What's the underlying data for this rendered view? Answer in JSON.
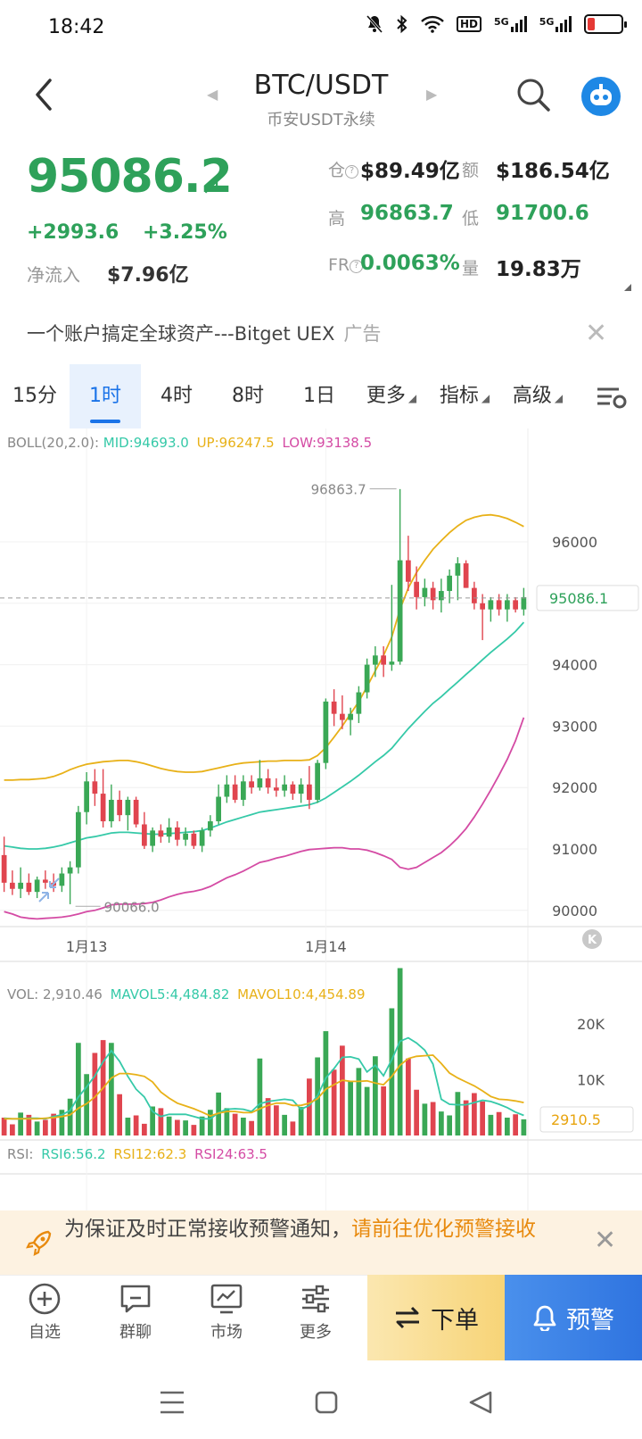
{
  "status_bar": {
    "time": "18:42",
    "battery_level": 0.2,
    "network_1": "5G",
    "network_2": "5G",
    "hd_badge": "HD"
  },
  "header": {
    "title": "BTC/USDT",
    "subtitle": "币安USDT永续"
  },
  "price": {
    "last": "95086.2",
    "change": "+2993.6",
    "change_pct": "+3.25%",
    "netflow_label": "净流入",
    "netflow_value": "$7.96亿"
  },
  "stats": {
    "oi_label": "仓",
    "oi_value": "$89.49亿",
    "amount_label": "额",
    "amount_value": "$186.54亿",
    "high_label": "高",
    "high_value": "96863.7",
    "low_label": "低",
    "low_value": "91700.6",
    "fr_label": "FR",
    "fr_value": "0.0063%",
    "vol_label": "量",
    "vol_value": "19.83万"
  },
  "ad": {
    "text": "一个账户搞定全球资产---Bitget UEX",
    "tag": "广告"
  },
  "tabs": [
    {
      "label": "15分"
    },
    {
      "label": "1时"
    },
    {
      "label": "4时"
    },
    {
      "label": "8时"
    },
    {
      "label": "1日"
    },
    {
      "label": "更多"
    },
    {
      "label": "指标"
    },
    {
      "label": "高级"
    }
  ],
  "chart_data": {
    "type": "candlestick",
    "boll": {
      "label": "BOLL(20,2.0):",
      "mid": "MID:94693.0",
      "up": "UP:96247.5",
      "low": "LOW:93138.5"
    },
    "price_axis": [
      "96000",
      "95000",
      "94000",
      "93000",
      "92000",
      "91000",
      "90000"
    ],
    "current_price_tag": "95086.1",
    "high_marker": "96863.7",
    "low_marker": "90066.0",
    "x_labels": [
      "1月13",
      "1月14"
    ],
    "vol": {
      "label": "VOL: 2,910.46",
      "mavol5": "MAVOL5:4,484.82",
      "mavol10": "MAVOL10:4,454.89"
    },
    "vol_axis": [
      "20K",
      "10K"
    ],
    "vol_tag": "2910.5",
    "rsi": {
      "label": "RSI:",
      "rsi6": "RSI6:56.2",
      "rsi12": "RSI12:62.3",
      "rsi24": "RSI24:63.5"
    },
    "colors": {
      "up": "#3aa856",
      "down": "#e0454f",
      "mid": "#35c9a8",
      "upper": "#e8b118",
      "lower": "#d44ba4"
    },
    "candles": [
      [
        90900,
        91200,
        90300,
        90450
      ],
      [
        90450,
        90650,
        90250,
        90350
      ],
      [
        90350,
        90700,
        90200,
        90450
      ],
      [
        90450,
        90600,
        90250,
        90300
      ],
      [
        90300,
        90550,
        90200,
        90500
      ],
      [
        90500,
        90650,
        90350,
        90450
      ],
      [
        90450,
        90600,
        90300,
        90400
      ],
      [
        90400,
        90700,
        90300,
        90600
      ],
      [
        90600,
        90800,
        90100,
        90700
      ],
      [
        90700,
        91700,
        90600,
        91600
      ],
      [
        91600,
        92250,
        91400,
        92100
      ],
      [
        92100,
        92300,
        91700,
        91900
      ],
      [
        91900,
        92300,
        91350,
        91450
      ],
      [
        91450,
        92050,
        91350,
        91800
      ],
      [
        91800,
        91950,
        91450,
        91550
      ],
      [
        91550,
        91850,
        91300,
        91800
      ],
      [
        91800,
        91850,
        91350,
        91400
      ],
      [
        91400,
        91600,
        91000,
        91050
      ],
      [
        91050,
        91350,
        90950,
        91300
      ],
      [
        91300,
        91400,
        91100,
        91200
      ],
      [
        91200,
        91500,
        91100,
        91350
      ],
      [
        91350,
        91450,
        91050,
        91150
      ],
      [
        91150,
        91350,
        91050,
        91250
      ],
      [
        91250,
        91300,
        91000,
        91050
      ],
      [
        91050,
        91350,
        90950,
        91300
      ],
      [
        91300,
        91550,
        91200,
        91450
      ],
      [
        91450,
        92050,
        91400,
        91850
      ],
      [
        91850,
        92200,
        91750,
        92050
      ],
      [
        92050,
        92200,
        91750,
        91800
      ],
      [
        91800,
        92200,
        91700,
        92100
      ],
      [
        92100,
        92200,
        91900,
        92000
      ],
      [
        92000,
        92450,
        91950,
        92150
      ],
      [
        92150,
        92300,
        91900,
        92000
      ],
      [
        92000,
        92150,
        91850,
        91950
      ],
      [
        91950,
        92200,
        91850,
        92050
      ],
      [
        92050,
        92100,
        91800,
        91900
      ],
      [
        91900,
        92150,
        91750,
        92050
      ],
      [
        92050,
        92350,
        91650,
        91800
      ],
      [
        91800,
        92450,
        91750,
        92400
      ],
      [
        92400,
        93450,
        92300,
        93400
      ],
      [
        93400,
        93600,
        93000,
        93200
      ],
      [
        93200,
        93500,
        92950,
        93100
      ],
      [
        93100,
        93300,
        92850,
        93200
      ],
      [
        93200,
        93650,
        93050,
        93550
      ],
      [
        93550,
        94100,
        93450,
        94000
      ],
      [
        94000,
        94300,
        93800,
        94150
      ],
      [
        94150,
        94300,
        93800,
        94000
      ],
      [
        94000,
        95300,
        93900,
        94050
      ],
      [
        94050,
        96860,
        94000,
        95700
      ],
      [
        95700,
        96100,
        95200,
        95350
      ],
      [
        95350,
        95600,
        94900,
        95100
      ],
      [
        95100,
        95400,
        94950,
        95250
      ],
      [
        95250,
        95350,
        94900,
        95050
      ],
      [
        95050,
        95400,
        94850,
        95200
      ],
      [
        95200,
        95550,
        95000,
        95450
      ],
      [
        95450,
        95750,
        95050,
        95650
      ],
      [
        95650,
        95700,
        95250,
        95250
      ],
      [
        95250,
        95350,
        94900,
        95000
      ],
      [
        95000,
        95150,
        94400,
        94900
      ],
      [
        94900,
        95100,
        94700,
        95050
      ],
      [
        95050,
        95150,
        94800,
        94900
      ],
      [
        94900,
        95150,
        94700,
        95050
      ],
      [
        95050,
        95100,
        94850,
        94900
      ],
      [
        94900,
        95250,
        94800,
        95100
      ]
    ],
    "volumes": [
      3200,
      2000,
      4100,
      3700,
      2500,
      2800,
      3900,
      4600,
      6600,
      16600,
      11000,
      14800,
      17100,
      16600,
      7400,
      3200,
      3600,
      2100,
      5200,
      4900,
      3400,
      2800,
      2700,
      1900,
      3400,
      4600,
      7700,
      4900,
      3900,
      3200,
      2600,
      13800,
      6700,
      5400,
      3700,
      2500,
      5100,
      10200,
      14000,
      18700,
      11800,
      16100,
      9800,
      12100,
      8700,
      14200,
      8800,
      22800,
      30000,
      13800,
      8200,
      5700,
      6000,
      4300,
      3600,
      7800,
      6300,
      7600,
      6100,
      3700,
      4200,
      3200,
      3800,
      2900
    ],
    "boll_mid": [
      91050,
      91030,
      91010,
      91000,
      91000,
      91010,
      91030,
      91060,
      91100,
      91140,
      91180,
      91200,
      91230,
      91260,
      91270,
      91270,
      91260,
      91250,
      91240,
      91240,
      91250,
      91260,
      91270,
      91280,
      91300,
      91340,
      91390,
      91440,
      91480,
      91520,
      91560,
      91600,
      91620,
      91640,
      91660,
      91680,
      91700,
      91720,
      91760,
      91830,
      91920,
      92010,
      92100,
      92200,
      92310,
      92420,
      92520,
      92640,
      92800,
      92960,
      93100,
      93240,
      93370,
      93480,
      93600,
      93720,
      93840,
      93960,
      94080,
      94200,
      94310,
      94420,
      94540,
      94690
    ],
    "boll_up": [
      92120,
      92120,
      92130,
      92130,
      92140,
      92150,
      92180,
      92230,
      92290,
      92340,
      92380,
      92400,
      92420,
      92430,
      92440,
      92440,
      92420,
      92390,
      92350,
      92310,
      92280,
      92260,
      92250,
      92250,
      92260,
      92290,
      92320,
      92350,
      92380,
      92400,
      92410,
      92420,
      92430,
      92430,
      92440,
      92440,
      92440,
      92450,
      92520,
      92650,
      92820,
      93000,
      93200,
      93400,
      93640,
      93900,
      94150,
      94450,
      94900,
      95250,
      95500,
      95700,
      95880,
      96020,
      96150,
      96260,
      96350,
      96400,
      96430,
      96440,
      96420,
      96380,
      96320,
      96250
    ],
    "boll_low": [
      89980,
      89940,
      89890,
      89870,
      89860,
      89870,
      89880,
      89890,
      89910,
      89940,
      89980,
      90000,
      90040,
      90090,
      90100,
      90100,
      90100,
      90110,
      90130,
      90170,
      90220,
      90260,
      90290,
      90310,
      90340,
      90390,
      90460,
      90530,
      90580,
      90640,
      90710,
      90780,
      90810,
      90850,
      90880,
      90920,
      90960,
      90990,
      91000,
      91010,
      91020,
      91020,
      91000,
      91000,
      90980,
      90940,
      90890,
      90830,
      90700,
      90670,
      90700,
      90780,
      90860,
      90940,
      91050,
      91180,
      91330,
      91520,
      91730,
      91960,
      92200,
      92460,
      92760,
      93140
    ],
    "mavol5": [
      3100,
      3000,
      3000,
      3100,
      3100,
      3000,
      3400,
      3700,
      4500,
      6900,
      8700,
      10700,
      13200,
      15200,
      13300,
      10600,
      8300,
      6900,
      4300,
      3400,
      3800,
      3800,
      3800,
      3400,
      3000,
      3000,
      4100,
      4700,
      4800,
      4700,
      4300,
      5700,
      6100,
      6300,
      6500,
      6300,
      4700,
      5400,
      7100,
      10300,
      12000,
      14000,
      14100,
      13700,
      11400,
      12600,
      10700,
      13600,
      16900,
      17500,
      16600,
      15300,
      12800,
      6500,
      5600,
      5500,
      5500,
      5900,
      6300,
      6100,
      5600,
      5000,
      4200,
      3600
    ],
    "mavol10": [
      3000,
      3000,
      3000,
      3000,
      3000,
      3100,
      3200,
      3400,
      3700,
      4900,
      5700,
      6900,
      8500,
      10300,
      11100,
      11100,
      10900,
      10600,
      9600,
      7800,
      6700,
      5800,
      5300,
      4800,
      4200,
      3500,
      4000,
      4300,
      4300,
      4100,
      4100,
      4800,
      5400,
      5800,
      5800,
      5400,
      5400,
      5800,
      6600,
      8300,
      9100,
      9900,
      9700,
      9700,
      9800,
      9400,
      9100,
      10600,
      12600,
      13800,
      14200,
      14300,
      14400,
      12900,
      11200,
      10300,
      9600,
      8900,
      8000,
      7000,
      6500,
      6400,
      6200,
      5900
    ]
  },
  "alert": {
    "text": "为保证及时正常接收预警通知，",
    "link": "请前往优化预警接收"
  },
  "bottom_nav": {
    "watchlist": "自选",
    "group_chat": "群聊",
    "market": "市场",
    "more": "更多",
    "order": "下单",
    "alarm": "预警"
  }
}
